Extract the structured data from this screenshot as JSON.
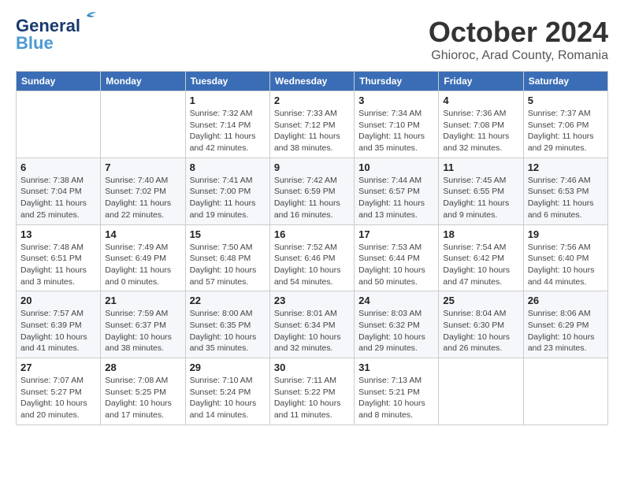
{
  "header": {
    "logo_line1": "General",
    "logo_line2": "Blue",
    "month_title": "October 2024",
    "location": "Ghioroc, Arad County, Romania"
  },
  "weekdays": [
    "Sunday",
    "Monday",
    "Tuesday",
    "Wednesday",
    "Thursday",
    "Friday",
    "Saturday"
  ],
  "weeks": [
    [
      {
        "day": "",
        "sunrise": "",
        "sunset": "",
        "daylight": ""
      },
      {
        "day": "",
        "sunrise": "",
        "sunset": "",
        "daylight": ""
      },
      {
        "day": "1",
        "sunrise": "Sunrise: 7:32 AM",
        "sunset": "Sunset: 7:14 PM",
        "daylight": "Daylight: 11 hours and 42 minutes."
      },
      {
        "day": "2",
        "sunrise": "Sunrise: 7:33 AM",
        "sunset": "Sunset: 7:12 PM",
        "daylight": "Daylight: 11 hours and 38 minutes."
      },
      {
        "day": "3",
        "sunrise": "Sunrise: 7:34 AM",
        "sunset": "Sunset: 7:10 PM",
        "daylight": "Daylight: 11 hours and 35 minutes."
      },
      {
        "day": "4",
        "sunrise": "Sunrise: 7:36 AM",
        "sunset": "Sunset: 7:08 PM",
        "daylight": "Daylight: 11 hours and 32 minutes."
      },
      {
        "day": "5",
        "sunrise": "Sunrise: 7:37 AM",
        "sunset": "Sunset: 7:06 PM",
        "daylight": "Daylight: 11 hours and 29 minutes."
      }
    ],
    [
      {
        "day": "6",
        "sunrise": "Sunrise: 7:38 AM",
        "sunset": "Sunset: 7:04 PM",
        "daylight": "Daylight: 11 hours and 25 minutes."
      },
      {
        "day": "7",
        "sunrise": "Sunrise: 7:40 AM",
        "sunset": "Sunset: 7:02 PM",
        "daylight": "Daylight: 11 hours and 22 minutes."
      },
      {
        "day": "8",
        "sunrise": "Sunrise: 7:41 AM",
        "sunset": "Sunset: 7:00 PM",
        "daylight": "Daylight: 11 hours and 19 minutes."
      },
      {
        "day": "9",
        "sunrise": "Sunrise: 7:42 AM",
        "sunset": "Sunset: 6:59 PM",
        "daylight": "Daylight: 11 hours and 16 minutes."
      },
      {
        "day": "10",
        "sunrise": "Sunrise: 7:44 AM",
        "sunset": "Sunset: 6:57 PM",
        "daylight": "Daylight: 11 hours and 13 minutes."
      },
      {
        "day": "11",
        "sunrise": "Sunrise: 7:45 AM",
        "sunset": "Sunset: 6:55 PM",
        "daylight": "Daylight: 11 hours and 9 minutes."
      },
      {
        "day": "12",
        "sunrise": "Sunrise: 7:46 AM",
        "sunset": "Sunset: 6:53 PM",
        "daylight": "Daylight: 11 hours and 6 minutes."
      }
    ],
    [
      {
        "day": "13",
        "sunrise": "Sunrise: 7:48 AM",
        "sunset": "Sunset: 6:51 PM",
        "daylight": "Daylight: 11 hours and 3 minutes."
      },
      {
        "day": "14",
        "sunrise": "Sunrise: 7:49 AM",
        "sunset": "Sunset: 6:49 PM",
        "daylight": "Daylight: 11 hours and 0 minutes."
      },
      {
        "day": "15",
        "sunrise": "Sunrise: 7:50 AM",
        "sunset": "Sunset: 6:48 PM",
        "daylight": "Daylight: 10 hours and 57 minutes."
      },
      {
        "day": "16",
        "sunrise": "Sunrise: 7:52 AM",
        "sunset": "Sunset: 6:46 PM",
        "daylight": "Daylight: 10 hours and 54 minutes."
      },
      {
        "day": "17",
        "sunrise": "Sunrise: 7:53 AM",
        "sunset": "Sunset: 6:44 PM",
        "daylight": "Daylight: 10 hours and 50 minutes."
      },
      {
        "day": "18",
        "sunrise": "Sunrise: 7:54 AM",
        "sunset": "Sunset: 6:42 PM",
        "daylight": "Daylight: 10 hours and 47 minutes."
      },
      {
        "day": "19",
        "sunrise": "Sunrise: 7:56 AM",
        "sunset": "Sunset: 6:40 PM",
        "daylight": "Daylight: 10 hours and 44 minutes."
      }
    ],
    [
      {
        "day": "20",
        "sunrise": "Sunrise: 7:57 AM",
        "sunset": "Sunset: 6:39 PM",
        "daylight": "Daylight: 10 hours and 41 minutes."
      },
      {
        "day": "21",
        "sunrise": "Sunrise: 7:59 AM",
        "sunset": "Sunset: 6:37 PM",
        "daylight": "Daylight: 10 hours and 38 minutes."
      },
      {
        "day": "22",
        "sunrise": "Sunrise: 8:00 AM",
        "sunset": "Sunset: 6:35 PM",
        "daylight": "Daylight: 10 hours and 35 minutes."
      },
      {
        "day": "23",
        "sunrise": "Sunrise: 8:01 AM",
        "sunset": "Sunset: 6:34 PM",
        "daylight": "Daylight: 10 hours and 32 minutes."
      },
      {
        "day": "24",
        "sunrise": "Sunrise: 8:03 AM",
        "sunset": "Sunset: 6:32 PM",
        "daylight": "Daylight: 10 hours and 29 minutes."
      },
      {
        "day": "25",
        "sunrise": "Sunrise: 8:04 AM",
        "sunset": "Sunset: 6:30 PM",
        "daylight": "Daylight: 10 hours and 26 minutes."
      },
      {
        "day": "26",
        "sunrise": "Sunrise: 8:06 AM",
        "sunset": "Sunset: 6:29 PM",
        "daylight": "Daylight: 10 hours and 23 minutes."
      }
    ],
    [
      {
        "day": "27",
        "sunrise": "Sunrise: 7:07 AM",
        "sunset": "Sunset: 5:27 PM",
        "daylight": "Daylight: 10 hours and 20 minutes."
      },
      {
        "day": "28",
        "sunrise": "Sunrise: 7:08 AM",
        "sunset": "Sunset: 5:25 PM",
        "daylight": "Daylight: 10 hours and 17 minutes."
      },
      {
        "day": "29",
        "sunrise": "Sunrise: 7:10 AM",
        "sunset": "Sunset: 5:24 PM",
        "daylight": "Daylight: 10 hours and 14 minutes."
      },
      {
        "day": "30",
        "sunrise": "Sunrise: 7:11 AM",
        "sunset": "Sunset: 5:22 PM",
        "daylight": "Daylight: 10 hours and 11 minutes."
      },
      {
        "day": "31",
        "sunrise": "Sunrise: 7:13 AM",
        "sunset": "Sunset: 5:21 PM",
        "daylight": "Daylight: 10 hours and 8 minutes."
      },
      {
        "day": "",
        "sunrise": "",
        "sunset": "",
        "daylight": ""
      },
      {
        "day": "",
        "sunrise": "",
        "sunset": "",
        "daylight": ""
      }
    ]
  ]
}
